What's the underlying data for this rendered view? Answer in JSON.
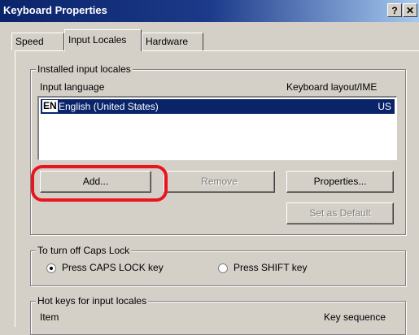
{
  "window": {
    "title": "Keyboard Properties",
    "help_label": "?",
    "close_label": "✕"
  },
  "tabs": [
    {
      "label": "Speed"
    },
    {
      "label": "Input Locales",
      "active": true
    },
    {
      "label": "Hardware"
    }
  ],
  "installed": {
    "legend": "Installed input locales",
    "col_language": "Input language",
    "col_layout": "Keyboard layout/IME",
    "items": [
      {
        "code": "EN",
        "name": "English (United States)",
        "layout": "US",
        "selected": true
      }
    ]
  },
  "buttons": {
    "add": "Add...",
    "remove": "Remove",
    "properties": "Properties...",
    "set_default": "Set as Default"
  },
  "caps_lock": {
    "legend": "To turn off Caps Lock",
    "option_caps": "Press CAPS LOCK key",
    "option_shift": "Press SHIFT key",
    "selected": "caps"
  },
  "hotkeys": {
    "legend": "Hot keys for input locales",
    "col_item": "Item",
    "col_sequence": "Key sequence"
  },
  "annotation_color": "#e8141e"
}
